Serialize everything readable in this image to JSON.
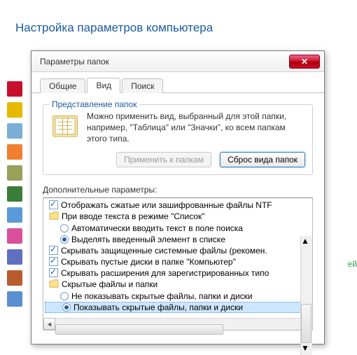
{
  "bgTitle": "Настройка параметров компьютера",
  "dialog": {
    "title": "Параметры папок",
    "tabs": [
      "Общие",
      "Вид",
      "Поиск"
    ],
    "activeTab": 1,
    "group": {
      "legend": "Представление папок",
      "desc": "Можно применить вид, выбранный для этой папки, например, \"Таблица\" или \"Значки\", ко всем папкам этого типа.",
      "applyBtn": "Применить к папкам",
      "resetBtn": "Сброс вида папок"
    },
    "advancedLabel": "Дополнительные параметры:",
    "tree": [
      {
        "kind": "check",
        "checked": true,
        "indent": 0,
        "label": "Отображать сжатые или зашифрованные файлы NTF"
      },
      {
        "kind": "folder",
        "indent": 0,
        "label": "При вводе текста в режиме \"Список\""
      },
      {
        "kind": "radio",
        "checked": false,
        "indent": 1,
        "label": "Автоматически вводить текст в поле поиска"
      },
      {
        "kind": "radio",
        "checked": true,
        "indent": 1,
        "label": "Выделять введенный элемент в списке"
      },
      {
        "kind": "check",
        "checked": true,
        "indent": 0,
        "label": "Скрывать защищенные системные файлы (рекомен."
      },
      {
        "kind": "check",
        "checked": true,
        "indent": 0,
        "label": "Скрывать пустые диски в папке \"Компьютер\""
      },
      {
        "kind": "check",
        "checked": true,
        "indent": 0,
        "label": "Скрывать расширения для зарегистрированных типо"
      },
      {
        "kind": "folder",
        "indent": 0,
        "label": "Скрытые файлы и папки"
      },
      {
        "kind": "radio",
        "checked": false,
        "indent": 1,
        "label": "Не показывать скрытые файлы, папки и диски"
      },
      {
        "kind": "radio",
        "checked": true,
        "indent": 1,
        "label": "Показывать скрытые файлы, папки и диски",
        "selected": true
      }
    ]
  },
  "greenHint": "ей",
  "sidebarColors": [
    "#c8102e",
    "#e6b800",
    "#7aaed6",
    "#f08030",
    "#9aa05a",
    "#3a7d3a",
    "#5a9ad8",
    "#d94f9b",
    "#6070c0",
    "#b85c2e",
    "#5a8fd0"
  ]
}
